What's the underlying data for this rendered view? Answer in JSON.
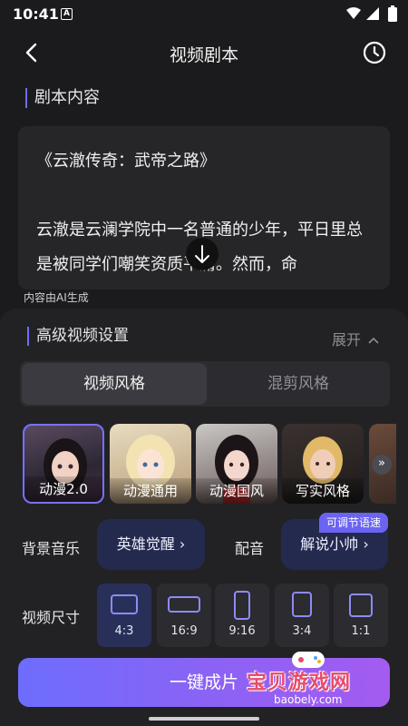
{
  "status_bar": {
    "time": "10:41",
    "notification_icon": "A"
  },
  "header": {
    "title": "视频剧本"
  },
  "script_section": {
    "title": "剧本内容",
    "text_line_1": "《云澈传奇：武帝之路》",
    "text_line_2": "云澈是云澜学院中一名普通的少年，平日里总是被同学们嘲笑资质平庸。然而，命",
    "ai_note": "内容由AI生成"
  },
  "advanced": {
    "title": "高级视频设置",
    "expand_label": "展开"
  },
  "tabs": [
    {
      "label": "视频风格"
    },
    {
      "label": "混剪风格"
    }
  ],
  "styles": [
    {
      "label": "动漫2.0",
      "selected": true
    },
    {
      "label": "动漫通用"
    },
    {
      "label": "动漫国风"
    },
    {
      "label": "写实风格"
    }
  ],
  "music": {
    "label": "背景音乐",
    "value": "英雄觉醒",
    "chevron": "›"
  },
  "voice": {
    "label": "配音",
    "value": "解说小帅",
    "chevron": "›",
    "badge": "可调节语速"
  },
  "size": {
    "label": "视频尺寸",
    "options": [
      {
        "label": "4:3",
        "selected": true
      },
      {
        "label": "16:9"
      },
      {
        "label": "9:16"
      },
      {
        "label": "3:4"
      },
      {
        "label": "1:1"
      }
    ]
  },
  "cta": {
    "label": "一键成片"
  },
  "watermark": {
    "main": "宝贝游戏网",
    "sub": "baobely.com"
  },
  "colors": {
    "accent": "#6f6cf6",
    "background": "#1b1b1d",
    "pill": "#242a4d"
  }
}
